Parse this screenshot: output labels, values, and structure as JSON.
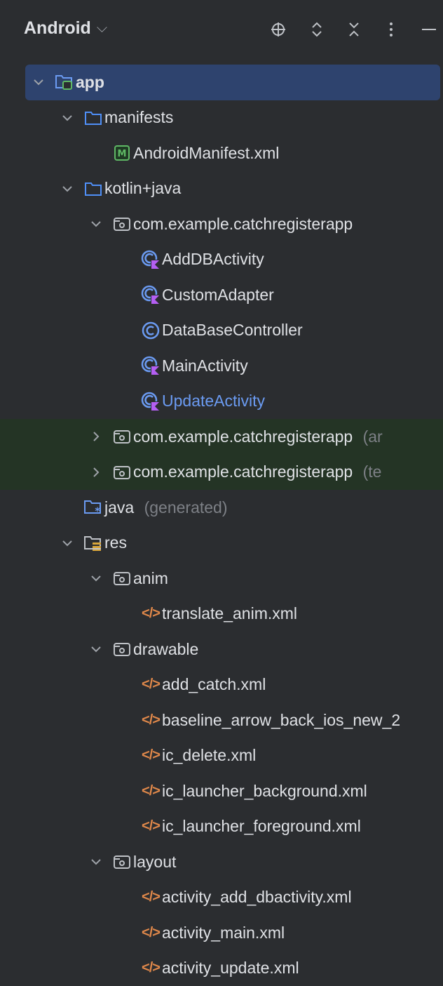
{
  "header": {
    "title": "Android",
    "tools": [
      "locate-icon",
      "expand-icon",
      "collapse-icon",
      "more-icon",
      "minimize-icon"
    ]
  },
  "tree": [
    {
      "label": "app",
      "extra": "",
      "level": 0,
      "expand": "open",
      "icon": "module-folder-icon",
      "selected": true
    },
    {
      "label": "manifests",
      "extra": "",
      "level": 1,
      "expand": "open",
      "icon": "folder-icon"
    },
    {
      "label": "AndroidManifest.xml",
      "extra": "",
      "level": 2,
      "expand": "none",
      "icon": "manifest-file-icon"
    },
    {
      "label": "kotlin+java",
      "extra": "",
      "level": 1,
      "expand": "open",
      "icon": "folder-icon"
    },
    {
      "label": "com.example.catchregisterapp",
      "extra": "",
      "level": 2,
      "expand": "open",
      "icon": "package-icon"
    },
    {
      "label": "AddDBActivity",
      "extra": "",
      "level": 3,
      "expand": "none",
      "icon": "kotlin-class-icon"
    },
    {
      "label": "CustomAdapter",
      "extra": "",
      "level": 3,
      "expand": "none",
      "icon": "kotlin-class-icon"
    },
    {
      "label": "DataBaseController",
      "extra": "",
      "level": 3,
      "expand": "none",
      "icon": "class-icon"
    },
    {
      "label": "MainActivity",
      "extra": "",
      "level": 3,
      "expand": "none",
      "icon": "kotlin-class-icon"
    },
    {
      "label": "UpdateActivity",
      "extra": "",
      "level": 3,
      "expand": "none",
      "icon": "kotlin-class-icon",
      "highlight": true
    },
    {
      "label": "com.example.catchregisterapp",
      "extra": "(ar",
      "level": 2,
      "expand": "closed",
      "icon": "package-icon",
      "green": true
    },
    {
      "label": "com.example.catchregisterapp",
      "extra": "(te",
      "level": 2,
      "expand": "closed",
      "icon": "package-icon",
      "green": true
    },
    {
      "label": "java",
      "extra": "(generated)",
      "level": 1,
      "expand": "none",
      "icon": "generated-folder-icon"
    },
    {
      "label": "res",
      "extra": "",
      "level": 1,
      "expand": "open",
      "icon": "resource-folder-icon"
    },
    {
      "label": "anim",
      "extra": "",
      "level": 2,
      "expand": "open",
      "icon": "package-icon"
    },
    {
      "label": "translate_anim.xml",
      "extra": "",
      "level": 3,
      "expand": "none",
      "icon": "xml-file-icon"
    },
    {
      "label": "drawable",
      "extra": "",
      "level": 2,
      "expand": "open",
      "icon": "package-icon"
    },
    {
      "label": "add_catch.xml",
      "extra": "",
      "level": 3,
      "expand": "none",
      "icon": "xml-file-icon"
    },
    {
      "label": "baseline_arrow_back_ios_new_2",
      "extra": "",
      "level": 3,
      "expand": "none",
      "icon": "xml-file-icon"
    },
    {
      "label": "ic_delete.xml",
      "extra": "",
      "level": 3,
      "expand": "none",
      "icon": "xml-file-icon"
    },
    {
      "label": "ic_launcher_background.xml",
      "extra": "",
      "level": 3,
      "expand": "none",
      "icon": "xml-file-icon"
    },
    {
      "label": "ic_launcher_foreground.xml",
      "extra": "",
      "level": 3,
      "expand": "none",
      "icon": "xml-file-icon"
    },
    {
      "label": "layout",
      "extra": "",
      "level": 2,
      "expand": "open",
      "icon": "package-icon"
    },
    {
      "label": "activity_add_dbactivity.xml",
      "extra": "",
      "level": 3,
      "expand": "none",
      "icon": "xml-file-icon"
    },
    {
      "label": "activity_main.xml",
      "extra": "",
      "level": 3,
      "expand": "none",
      "icon": "xml-file-icon"
    },
    {
      "label": "activity_update.xml",
      "extra": "",
      "level": 3,
      "expand": "none",
      "icon": "xml-file-icon"
    }
  ]
}
